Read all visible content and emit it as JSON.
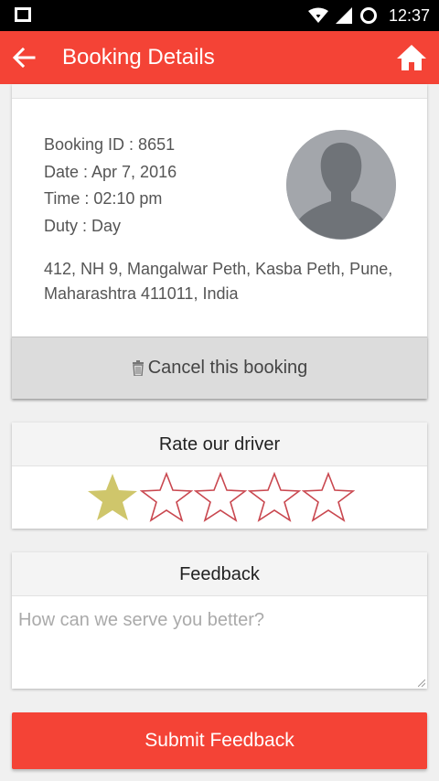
{
  "status_bar": {
    "time": "12:37"
  },
  "app_bar": {
    "title": "Booking Details",
    "back_icon": "arrow-left-icon",
    "home_icon": "home-icon"
  },
  "booking": {
    "booking_id": "Booking ID : 8651",
    "date": "Date : Apr 7, 2016",
    "time": "Time : 02:10 pm",
    "duty": "Duty : Day",
    "address_line1": "412, NH 9, Mangalwar Peth, Kasba Peth, Pune,",
    "address_line2": "Maharashtra 411011, India",
    "cancel_label": "Cancel this booking"
  },
  "rating": {
    "header": "Rate our driver",
    "value": 1,
    "max": 5,
    "filled_color": "#cfc66b",
    "empty_stroke_color": "#c9474f"
  },
  "feedback": {
    "header": "Feedback",
    "placeholder": "How can we serve you better?",
    "value": ""
  },
  "submit": {
    "label": "Submit Feedback"
  },
  "colors": {
    "accent": "#f44336",
    "status_bar": "#000000"
  }
}
